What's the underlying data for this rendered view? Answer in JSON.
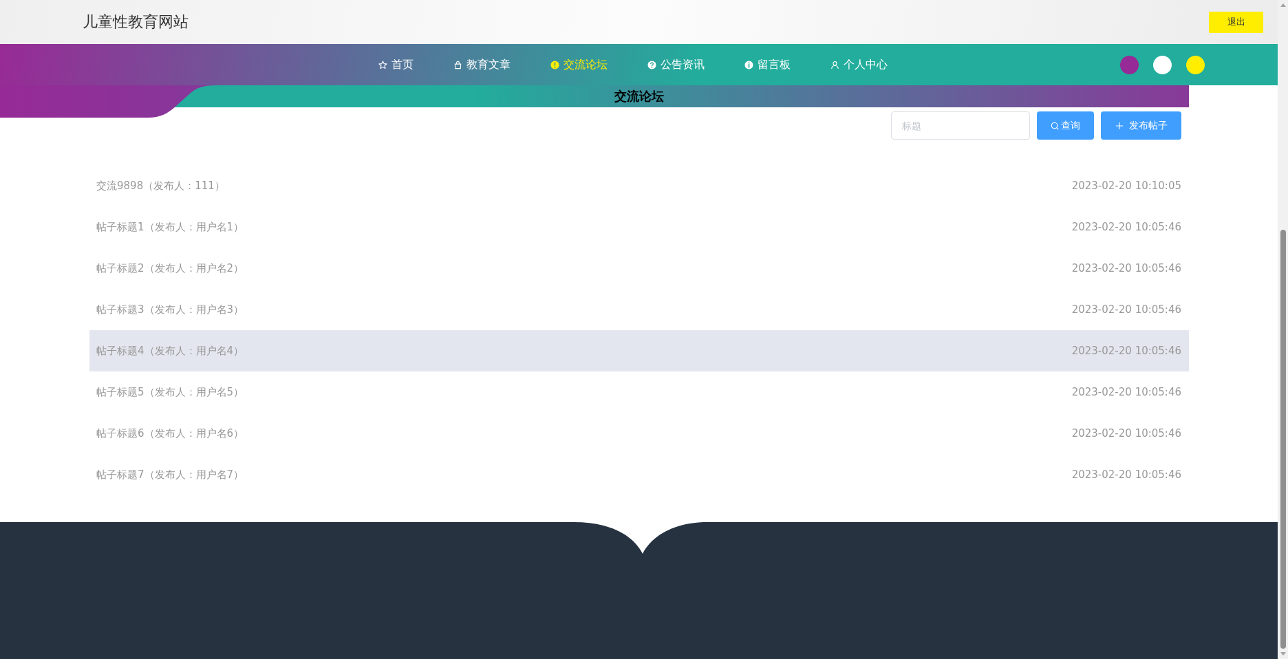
{
  "header": {
    "site_title": "儿童性教育网站",
    "logout_button": "退出"
  },
  "nav": {
    "items": [
      {
        "label": "首页",
        "selected": false
      },
      {
        "label": "教育文章",
        "selected": false
      },
      {
        "label": "交流论坛",
        "selected": true
      },
      {
        "label": "公告资讯",
        "selected": false
      },
      {
        "label": "留言板",
        "selected": false
      },
      {
        "label": "个人中心",
        "selected": false
      }
    ],
    "theme_swatches": [
      {
        "color": "#962a96"
      },
      {
        "color": "#ffffff"
      },
      {
        "color": "#ffee00"
      }
    ]
  },
  "page_title": "交流论坛",
  "toolbar": {
    "search": {
      "placeholder": "标题"
    },
    "query_button": "查询",
    "publish_button": "发布帖子"
  },
  "posts": [
    {
      "title": "交流9898（发布人：111）",
      "time": "2023-02-20 10:10:05",
      "selected": false
    },
    {
      "title": "帖子标题1（发布人：用户名1）",
      "time": "2023-02-20 10:05:46",
      "selected": false
    },
    {
      "title": "帖子标题2（发布人：用户名2）",
      "time": "2023-02-20 10:05:46",
      "selected": false
    },
    {
      "title": "帖子标题3（发布人：用户名3）",
      "time": "2023-02-20 10:05:46",
      "selected": false
    },
    {
      "title": "帖子标题4（发布人：用户名4）",
      "time": "2023-02-20 10:05:46",
      "selected": true
    },
    {
      "title": "帖子标题5（发布人：用户名5）",
      "time": "2023-02-20 10:05:46",
      "selected": false
    },
    {
      "title": "帖子标题6（发布人：用户名6）",
      "time": "2023-02-20 10:05:46",
      "selected": false
    },
    {
      "title": "帖子标题7（发布人：用户名7）",
      "time": "2023-02-20 10:05:46",
      "selected": false
    }
  ]
}
